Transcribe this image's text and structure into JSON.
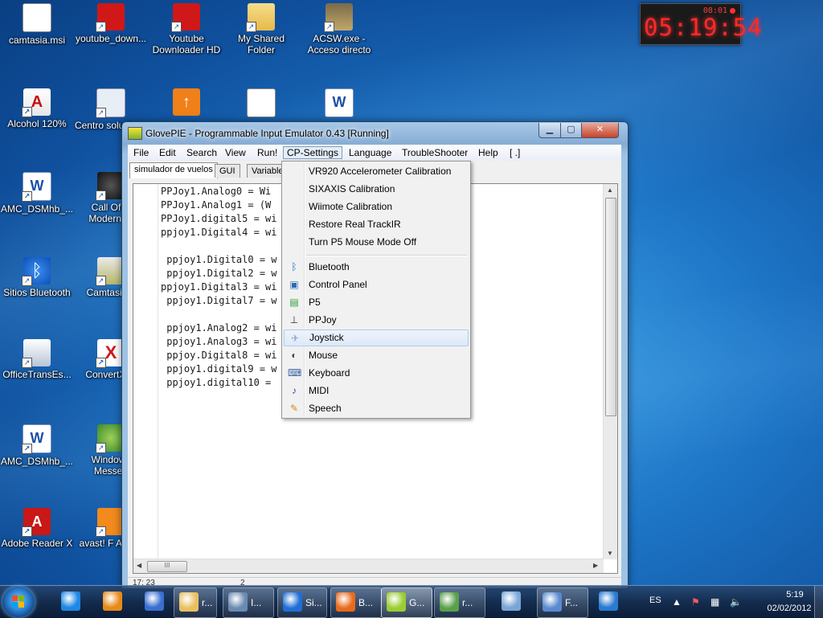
{
  "desktop": {
    "icons": [
      {
        "label": "camtasia.msi"
      },
      {
        "label": "youtube_down..."
      },
      {
        "label": "Youtube Downloader HD"
      },
      {
        "label": "My Shared Folder"
      },
      {
        "label": "ACSW.exe - Acceso directo"
      },
      {
        "label": "Alcohol 120%"
      },
      {
        "label": "Centro solucione"
      },
      {
        "label": "AMC_DSMhb_..."
      },
      {
        "label": "Call Of D Modern W"
      },
      {
        "label": "Sitios Bluetooth"
      },
      {
        "label": "Camtasia 7"
      },
      {
        "label": "OfficeTransEs..."
      },
      {
        "label": "ConvertXt 3"
      },
      {
        "label": "AMC_DSMhb_..."
      },
      {
        "label": "Windows Messen"
      },
      {
        "label": "Adobe Reader X"
      },
      {
        "label": "avast! F Antivir"
      }
    ]
  },
  "clock_gadget": {
    "time": "05:19:54",
    "small": "08:01"
  },
  "window": {
    "title": "GlovePIE - Programmable Input Emulator 0.43 [Running]",
    "minimize": "▁",
    "maximize": "▢",
    "close": "✕",
    "menu": [
      "File",
      "Edit",
      "Search",
      "View",
      "Run!",
      "CP-Settings",
      "Language",
      "TroubleShooter",
      "Help",
      "[ .]"
    ],
    "tabs": [
      "simulador de vuelos",
      "GUI",
      "Variable"
    ],
    "code_lines": [
      "PPJoy1.Analog0 = Wi",
      "PPJoy1.Analog1 = (W",
      "PPJoy1.digital5 = wi",
      "ppjoy1.Digital4 = wi",
      "",
      " ppjoy1.Digital0 = w",
      " ppjoy1.Digital2 = w",
      "ppjoy1.Digital3 = wi",
      " ppjoy1.Digital7 = w",
      "",
      " ppjoy1.Analog2 = wi",
      " ppjoy1.Analog3 = wi",
      " ppjoy.Digital8 = wi",
      " ppjoy1.digital9 = w",
      " ppjoy1.digital10 = "
    ],
    "hscroll_grip": "III",
    "status": [
      "17: 23",
      "2"
    ]
  },
  "cp_settings_menu": {
    "group1": [
      "VR920 Accelerometer Calibration",
      "SIXAXIS Calibration",
      "Wiimote Calibration",
      "Restore Real TrackIR",
      "Turn P5 Mouse Mode Off"
    ],
    "group2": [
      {
        "label": "Bluetooth",
        "icon": "bluetooth-icon",
        "glyph": "ᛒ"
      },
      {
        "label": "Control Panel",
        "icon": "control-panel-icon",
        "glyph": "▣"
      },
      {
        "label": "P5",
        "icon": "p5-glove-icon",
        "glyph": "▤"
      },
      {
        "label": "PPJoy",
        "icon": "ppjoy-icon",
        "glyph": "⊥"
      },
      {
        "label": "Joystick",
        "icon": "joystick-icon",
        "glyph": "✈"
      },
      {
        "label": "Mouse",
        "icon": "mouse-icon",
        "glyph": "◐"
      },
      {
        "label": "Keyboard",
        "icon": "keyboard-icon",
        "glyph": "⌨"
      },
      {
        "label": "MIDI",
        "icon": "midi-icon",
        "glyph": "♪"
      },
      {
        "label": "Speech",
        "icon": "speech-icon",
        "glyph": "✎"
      }
    ],
    "highlighted": "Joystick"
  },
  "taskbar": {
    "items": [
      {
        "label": "",
        "icon": "internet-explorer-icon"
      },
      {
        "label": "",
        "icon": "media-player-icon"
      },
      {
        "label": "",
        "icon": "user-app-icon"
      },
      {
        "label": "r...",
        "icon": "folder-icon"
      },
      {
        "label": "I...",
        "icon": "laptop-icon"
      },
      {
        "label": "Si...",
        "icon": "bluetooth-icon"
      },
      {
        "label": "B...",
        "icon": "firefox-icon"
      },
      {
        "label": "G...",
        "icon": "glovepie-icon"
      },
      {
        "label": "r...",
        "icon": "messenger-icon"
      },
      {
        "label": "",
        "icon": "contacts-icon"
      },
      {
        "label": "F...",
        "icon": "people-icon"
      },
      {
        "label": "",
        "icon": "arch-app-icon"
      }
    ],
    "tray": {
      "language": "ES",
      "time": "5:19",
      "date": "02/02/2012"
    }
  }
}
